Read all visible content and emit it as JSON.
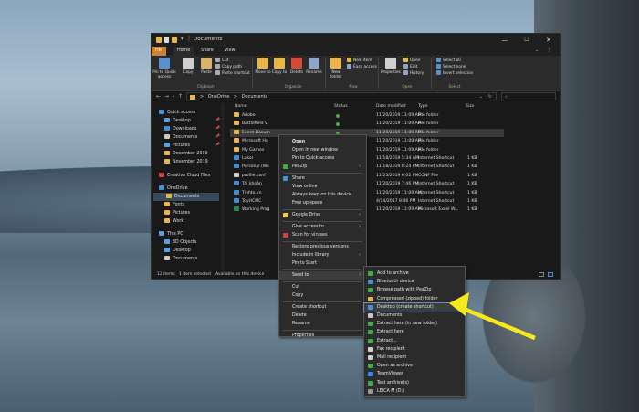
{
  "window": {
    "title": "Documents",
    "controls": [
      "—",
      "☐",
      "✕"
    ]
  },
  "ribbon": {
    "tabs": [
      "File",
      "Home",
      "Share",
      "View"
    ],
    "clipboard": {
      "pin": "Pin to Quick access",
      "copy": "Copy",
      "paste": "Paste",
      "cut": "Cut",
      "copy_path": "Copy path",
      "paste_shortcut": "Paste shortcut",
      "group": "Clipboard"
    },
    "organize": {
      "move": "Move to",
      "copy": "Copy to",
      "delete": "Delete",
      "rename": "Rename",
      "group": "Organize"
    },
    "new": {
      "folder": "New folder",
      "item": "New item",
      "easy": "Easy access",
      "group": "New"
    },
    "open": {
      "properties": "Properties",
      "open": "Open",
      "edit": "Edit",
      "history": "History",
      "group": "Open"
    },
    "select": {
      "all": "Select all",
      "none": "Select none",
      "invert": "Invert selection",
      "group": "Select"
    }
  },
  "address": {
    "path": [
      "OneDrive",
      "Documents"
    ],
    "sep": ">"
  },
  "sidebar": {
    "items": [
      {
        "label": "Quick access",
        "color": "#4a90d9"
      },
      {
        "label": "Desktop",
        "color": "#5aa0e0"
      },
      {
        "label": "Downloads",
        "color": "#3f8fd6"
      },
      {
        "label": "Documents",
        "color": "#c8c8c8"
      },
      {
        "label": "Pictures",
        "color": "#5aa0e0"
      },
      {
        "label": "December 2019",
        "color": "#e8b64a"
      },
      {
        "label": "November 2019",
        "color": "#e8b64a"
      },
      {
        "label": "Creative Cloud Files",
        "color": "#d8473e"
      },
      {
        "label": "OneDrive",
        "color": "#4a90d9"
      },
      {
        "label": "Documents",
        "color": "#e8b64a"
      },
      {
        "label": "Fonts",
        "color": "#e8b64a"
      },
      {
        "label": "Pictures",
        "color": "#e8b64a"
      },
      {
        "label": "Work",
        "color": "#e8b64a"
      },
      {
        "label": "This PC",
        "color": "#5aa0e0"
      },
      {
        "label": "3D Objects",
        "color": "#5aa0e0"
      },
      {
        "label": "Desktop",
        "color": "#5aa0e0"
      },
      {
        "label": "Documents",
        "color": "#c8c8c8"
      }
    ]
  },
  "files": {
    "headers": [
      "Name",
      "Status",
      "Date modified",
      "Type",
      "Size"
    ],
    "rows": [
      {
        "name": "Adobe",
        "date": "11/20/2019 11:09 AM",
        "type": "File folder",
        "size": "",
        "icon": "#e8b64a"
      },
      {
        "name": "Battlefield V",
        "date": "11/20/2019 11:09 AM",
        "type": "File folder",
        "size": "",
        "icon": "#e8b64a"
      },
      {
        "name": "Event Docum",
        "date": "11/20/2019 11:09 AM",
        "type": "File folder",
        "size": "",
        "icon": "#e8b64a"
      },
      {
        "name": "Microsoft Ha",
        "date": "11/20/2019 11:09 AM",
        "type": "File folder",
        "size": "",
        "icon": "#e8b64a"
      },
      {
        "name": "My Games",
        "date": "11/20/2019 11:09 AM",
        "type": "File folder",
        "size": "",
        "icon": "#e8b64a"
      },
      {
        "name": "Lakor",
        "date": "11/18/2019 5:34 AM",
        "type": "Internet Shortcut",
        "size": "1 KB",
        "icon": "#3f8fd6"
      },
      {
        "name": "Personal (We",
        "date": "11/18/2019 8:24 PM",
        "type": "Internet Shortcut",
        "size": "1 KB",
        "icon": "#3f8fd6"
      },
      {
        "name": "profile.conf",
        "date": "11/25/2019 6:02 PM",
        "type": "CONF File",
        "size": "1 KB",
        "icon": "#cfcfcf"
      },
      {
        "name": "Tài khoản",
        "date": "11/20/2019 7:46 PM",
        "type": "Internet Shortcut",
        "size": "1 KB",
        "icon": "#3f8fd6"
      },
      {
        "name": "Tinhte.vn",
        "date": "11/20/2019 11:09 AM",
        "type": "Internet Shortcut",
        "size": "1 KB",
        "icon": "#3f8fd6"
      },
      {
        "name": "ToyHCMC",
        "date": "4/14/2017 8:46 PM",
        "type": "Internet Shortcut",
        "size": "1 KB",
        "icon": "#3f8fd6"
      },
      {
        "name": "Working Prog",
        "date": "11/20/2019 11:09 AM",
        "type": "Microsoft Excel W...",
        "size": "1 KB",
        "icon": "#2f8a4a"
      }
    ]
  },
  "statusbar": {
    "count": "12 items",
    "selected": "1 item selected",
    "availability": "Available on this device"
  },
  "context_menu": {
    "items": [
      {
        "label": "Open",
        "bold": true
      },
      {
        "label": "Open in new window"
      },
      {
        "label": "Pin to Quick access"
      },
      {
        "label": "PeaZip",
        "arrow": true,
        "icon": "#3fae49"
      },
      {
        "sep": true
      },
      {
        "label": "Share",
        "icon": "#4a90d9"
      },
      {
        "label": "View online"
      },
      {
        "label": "Always keep on this device"
      },
      {
        "label": "Free up space"
      },
      {
        "sep": true
      },
      {
        "label": "Google Drive",
        "arrow": true,
        "icon": "#f2c94c"
      },
      {
        "sep": true
      },
      {
        "label": "Give access to",
        "arrow": true
      },
      {
        "label": "Scan for viruses",
        "icon": "#cc4444"
      },
      {
        "sep": true
      },
      {
        "label": "Restore previous versions"
      },
      {
        "label": "Include in library",
        "arrow": true
      },
      {
        "label": "Pin to Start"
      },
      {
        "sep": true
      },
      {
        "label": "Send to",
        "arrow": true,
        "hover": true
      },
      {
        "sep": true
      },
      {
        "label": "Cut"
      },
      {
        "label": "Copy"
      },
      {
        "sep": true
      },
      {
        "label": "Create shortcut"
      },
      {
        "label": "Delete"
      },
      {
        "label": "Rename"
      },
      {
        "sep": true
      },
      {
        "label": "Properties"
      }
    ]
  },
  "send_to_menu": {
    "items": [
      {
        "label": "Add to archive",
        "icon": "#3fae49"
      },
      {
        "label": "Bluetooth device",
        "icon": "#4a90d9"
      },
      {
        "label": "Browse path with PeaZip",
        "icon": "#3fae49"
      },
      {
        "label": "Compressed (zipped) folder",
        "icon": "#e8b64a"
      },
      {
        "label": "Desktop (create shortcut)",
        "icon": "#4a90d9",
        "hover": true
      },
      {
        "label": "Documents",
        "icon": "#c8c8c8"
      },
      {
        "label": "Extract here (in new folder)",
        "icon": "#3fae49"
      },
      {
        "label": "Extract here",
        "icon": "#3fae49"
      },
      {
        "label": "Extract...",
        "icon": "#3fae49"
      },
      {
        "label": "Fax recipient",
        "icon": "#cfcfcf"
      },
      {
        "label": "Mail recipient",
        "icon": "#cfcfcf"
      },
      {
        "label": "Open as archive",
        "icon": "#3fae49"
      },
      {
        "label": "TeamViewer",
        "icon": "#2d8ceb"
      },
      {
        "label": "Test archive(s)",
        "icon": "#3fae49"
      },
      {
        "label": "LEICA M (D:)",
        "icon": "#999999"
      }
    ]
  },
  "arrow_color": "#f7e91b"
}
